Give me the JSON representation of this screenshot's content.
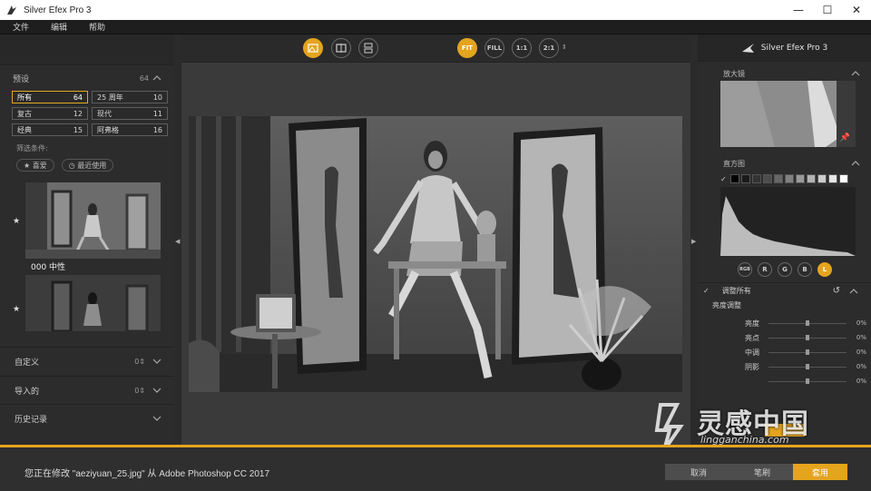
{
  "window": {
    "title": "Silver Efex Pro 3"
  },
  "menu": [
    "文件",
    "编辑",
    "帮助"
  ],
  "presets": {
    "title": "预设",
    "count": "64",
    "items": [
      {
        "label": "所有",
        "count": "64"
      },
      {
        "label": "25 周年",
        "count": "10"
      },
      {
        "label": "复古",
        "count": "12"
      },
      {
        "label": "现代",
        "count": "11"
      },
      {
        "label": "经典",
        "count": "15"
      },
      {
        "label": "阿弗格",
        "count": "16"
      }
    ],
    "filter_label": "筛选条件:",
    "filters": [
      "★ 喜爱",
      "◷ 最近使用"
    ],
    "thumb_label": "000 中性"
  },
  "collapsed_sections": [
    {
      "label": "自定义",
      "count": "0"
    },
    {
      "label": "导入的",
      "count": "0"
    },
    {
      "label": "历史记录",
      "count": ""
    }
  ],
  "toolbar": {
    "zoom_buttons": [
      "FIT",
      "FILL",
      "1:1",
      "2:1"
    ]
  },
  "right_panel": {
    "brand": "Silver Efex Pro 3",
    "loupe_title": "放大镜",
    "histogram_title": "直方图",
    "channels": [
      "RGB",
      "R",
      "G",
      "B",
      "L"
    ],
    "adjust_title": "调整所有",
    "brightness_title": "亮度调整",
    "sliders": [
      {
        "label": "亮度",
        "value": "0%"
      },
      {
        "label": "亮点",
        "value": "0%"
      },
      {
        "label": "中调",
        "value": "0%"
      },
      {
        "label": "阴影",
        "value": "0%"
      },
      {
        "label": "",
        "value": "0%"
      }
    ]
  },
  "status": {
    "message": "您正在修改 \"aeziyuan_25.jpg\" 从 Adobe Photoshop CC 2017",
    "buttons": [
      "取消",
      "笔刷",
      "套用"
    ]
  },
  "watermark": {
    "title": "灵感中国",
    "subtitle": "lingganchina.com"
  }
}
